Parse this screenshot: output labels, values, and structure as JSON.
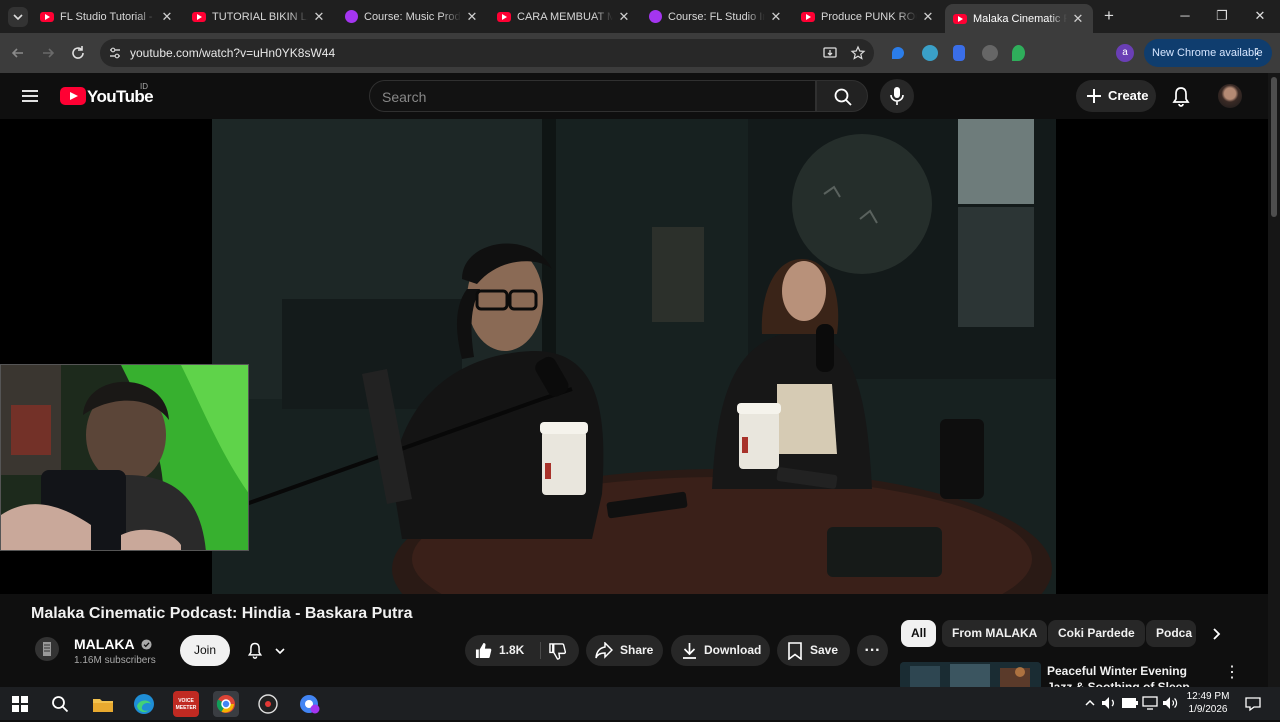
{
  "browser": {
    "tabs": [
      {
        "label": "FL Studio Tutorial - C",
        "favicon": "youtube-icon"
      },
      {
        "label": "TUTORIAL BIKIN LAG",
        "favicon": "youtube-icon"
      },
      {
        "label": "Course: Music Produ",
        "favicon": "udemy-icon"
      },
      {
        "label": "CARA MEMBUAT MU",
        "favicon": "youtube-icon"
      },
      {
        "label": "Course: FL Studio In",
        "favicon": "udemy-icon"
      },
      {
        "label": "Produce PUNK ROCK",
        "favicon": "youtube-icon"
      },
      {
        "label": "Malaka Cinematic P",
        "favicon": "youtube-icon",
        "active": true
      }
    ],
    "url": "youtube.com/watch?v=uHn0YK8sW44",
    "update_label": "New Chrome available",
    "profile_initial": "a"
  },
  "youtube": {
    "logo_text": "YouTube",
    "region": "ID",
    "search_placeholder": "Search",
    "create_label": "Create"
  },
  "video": {
    "title": "Malaka Cinematic Podcast: Hindia - Baskara Putra",
    "channel": "MALAKA",
    "subscribers": "1.16M subscribers",
    "join_label": "Join",
    "likes": "1.8K",
    "share_label": "Share",
    "download_label": "Download",
    "save_label": "Save",
    "verified": true
  },
  "chips": [
    "All",
    "From MALAKA",
    "Coki Pardede",
    "Podca"
  ],
  "recommendation": {
    "title": "Peaceful Winter Evening Jazz & Soothing of Sleep Jazz Pia"
  },
  "taskbar": {
    "time": "12:49 PM",
    "date": "1/9/2026",
    "voicemeeter_label": "VOICE MEETER"
  },
  "colors": {
    "youtube_red": "#ff0033",
    "background": "#0f0f0f",
    "udemy_purple": "#a435f0",
    "update_chip": "#0f3d6e"
  }
}
